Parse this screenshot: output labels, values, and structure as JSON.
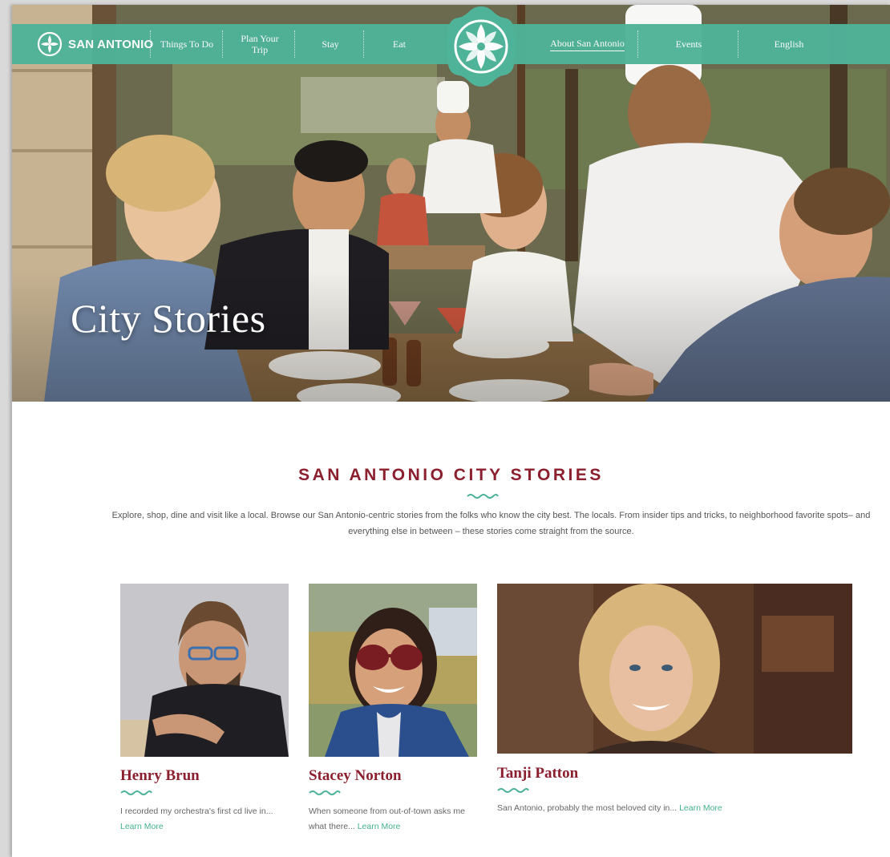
{
  "nav": {
    "logo_text": "SAN ANTONIO",
    "items": [
      {
        "label": "Things To Do"
      },
      {
        "label": "Plan Your Trip"
      },
      {
        "label": "Stay"
      },
      {
        "label": "Eat"
      },
      {
        "label": "About San Antonio"
      },
      {
        "label": "Events"
      },
      {
        "label": "English"
      }
    ],
    "active_item": "About San Antonio"
  },
  "hero": {
    "title": "City Stories"
  },
  "intro": {
    "heading": "SAN ANTONIO CITY STORIES",
    "text": "Explore, shop, dine and visit like a local. Browse our San Antonio-centric stories from the folks who know the city best. The locals. From insider tips and tricks, to neighborhood favorite spots– and everything else in between – these stories come straight from the source."
  },
  "stories": [
    {
      "name": "Henry Brun",
      "excerpt": "I recorded my orchestra's first cd live in...",
      "link": "Learn More"
    },
    {
      "name": "Stacey Norton",
      "excerpt": "When someone from out-of-town asks me what there...",
      "link": "Learn More"
    },
    {
      "name": "Tanji Patton",
      "excerpt": "San Antonio, probably the most beloved city in...",
      "link": "Learn More"
    }
  ],
  "colors": {
    "nav_green": "#4fb399",
    "heading_maroon": "#8b1f2e",
    "link_green": "#45b08f"
  },
  "icons": {
    "logo": "floral-star-icon",
    "badge": "floral-star-icon",
    "underline": "wave-squiggle-icon"
  }
}
